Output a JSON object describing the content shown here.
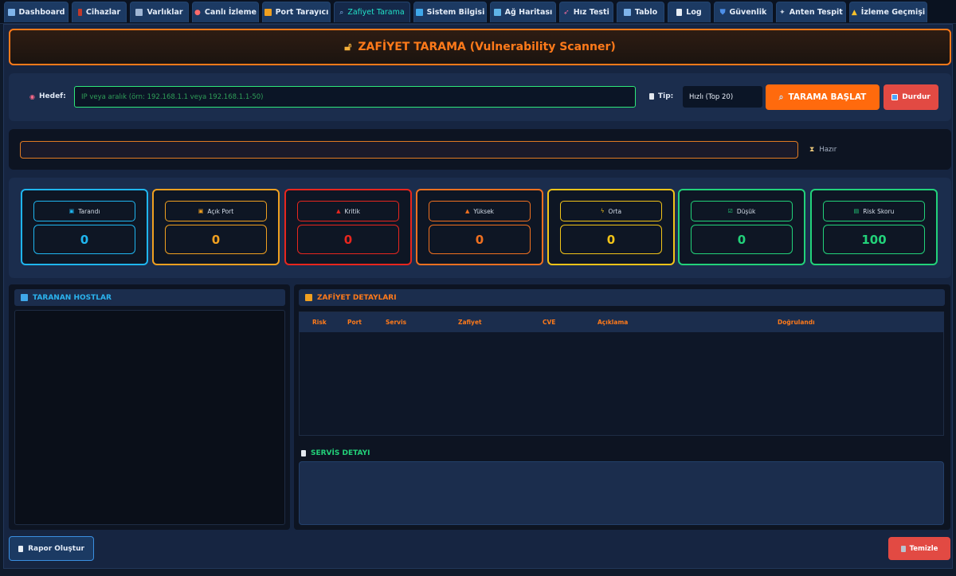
{
  "tabs": [
    {
      "label": "Dashboard",
      "icon": "chart-icon"
    },
    {
      "label": "Cihazlar",
      "icon": "phone-icon"
    },
    {
      "label": "Varlıklar",
      "icon": "building-icon"
    },
    {
      "label": "Canlı İzleme",
      "icon": "eye-icon"
    },
    {
      "label": "Port Tarayıcı",
      "icon": "lock-icon"
    },
    {
      "label": "Zafiyet Tarama",
      "icon": "search-icon",
      "active": true
    },
    {
      "label": "Sistem Bilgisi",
      "icon": "monitor-icon"
    },
    {
      "label": "Ağ Haritası",
      "icon": "map-icon"
    },
    {
      "label": "Hız Testi",
      "icon": "rocket-icon"
    },
    {
      "label": "Tablo",
      "icon": "chart-icon"
    },
    {
      "label": "Log",
      "icon": "document-icon"
    },
    {
      "label": "Güvenlik",
      "icon": "shield-icon"
    },
    {
      "label": "Anten Tespit",
      "icon": "satellite-icon"
    },
    {
      "label": "İzleme Geçmişi",
      "icon": "bell-icon"
    }
  ],
  "header": {
    "title": "ZAFİYET TARAMA (Vulnerability Scanner)"
  },
  "controls": {
    "target_label": "Hedef:",
    "target_placeholder": "IP veya aralık (örn: 192.168.1.1 veya 192.168.1.1-50)",
    "type_label": "Tip:",
    "type_value": "Hızlı (Top 20)",
    "scan_button": "TARAMA BAŞLAT",
    "stop_button": "Durdur"
  },
  "progress": {
    "value": 0,
    "status": "Hazır"
  },
  "stats": [
    {
      "label": "Tarandı",
      "value": "0",
      "color": "#1fb6f0",
      "icon": "monitor-icon"
    },
    {
      "label": "Açık Port",
      "value": "0",
      "color": "#f0a020",
      "icon": "lock-icon"
    },
    {
      "label": "Kritik",
      "value": "0",
      "color": "#e8261e",
      "icon": "siren-icon"
    },
    {
      "label": "Yüksek",
      "value": "0",
      "color": "#f07020",
      "icon": "warning-icon"
    },
    {
      "label": "Orta",
      "value": "0",
      "color": "#f2c418",
      "icon": "lightning-icon"
    },
    {
      "label": "Düşük",
      "value": "0",
      "color": "#22d27a",
      "icon": "checkbox-icon"
    },
    {
      "label": "Risk Skoru",
      "value": "100",
      "color": "#22d27a",
      "icon": "chart-icon"
    }
  ],
  "hosts": {
    "title": "TARANAN HOSTLAR",
    "color": "#2bb3ee"
  },
  "details": {
    "title": "ZAFİYET DETAYLARI",
    "columns": [
      "Risk",
      "Port",
      "Servis",
      "Zafiyet",
      "CVE",
      "Açıklama",
      "Doğrulandı"
    ]
  },
  "service": {
    "title": "SERVİS DETAYI",
    "color": "#22d27a"
  },
  "footer": {
    "report_button": "Rapor Oluştur",
    "clear_button": "Temizle"
  },
  "colors": {
    "accent": "#ff7a1a",
    "danger": "#e24a43",
    "success": "#22d27a"
  }
}
